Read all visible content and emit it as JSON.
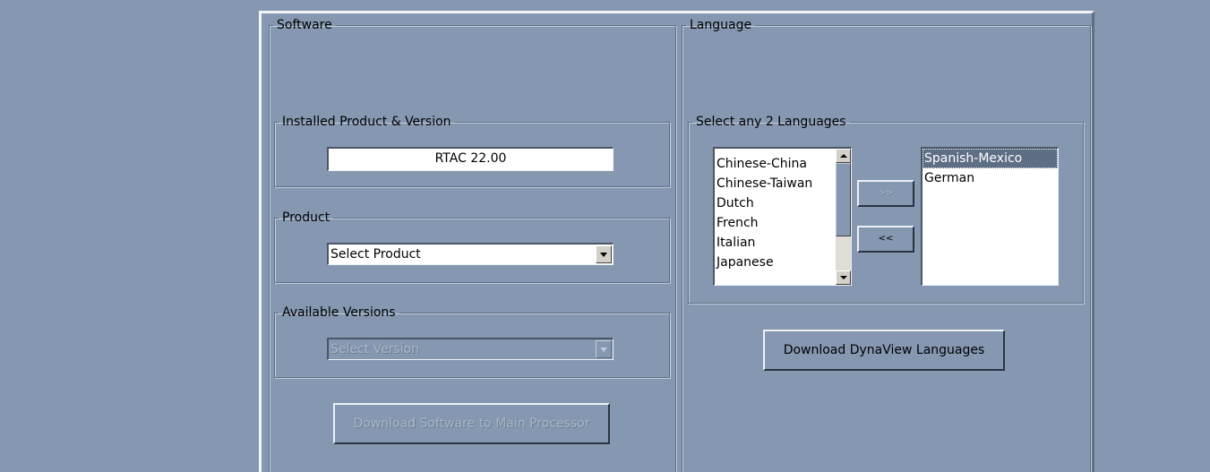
{
  "software": {
    "title": "Software",
    "installed": {
      "title": "Installed Product & Version",
      "value": "RTAC 22.00"
    },
    "product": {
      "title": "Product",
      "selected": "Select Product"
    },
    "versions": {
      "title": "Available Versions",
      "selected": "Select Version"
    },
    "download_button": "Download Software to Main Processor"
  },
  "language": {
    "title": "Language",
    "select_group_title": "Select any 2 Languages",
    "available": [
      "Chinese-China",
      "Chinese-Taiwan",
      "Dutch",
      "French",
      "Italian",
      "Japanese"
    ],
    "chosen": [
      "Spanish-Mexico",
      "German"
    ],
    "add_button": ">>",
    "remove_button": "<<",
    "download_button": "Download DynaView Languages"
  },
  "colors": {
    "background": "#8597b1",
    "selection": "#5e6e85"
  },
  "icons": [
    "dropdown-arrow-icon",
    "scroll-up-icon",
    "scroll-down-icon"
  ]
}
